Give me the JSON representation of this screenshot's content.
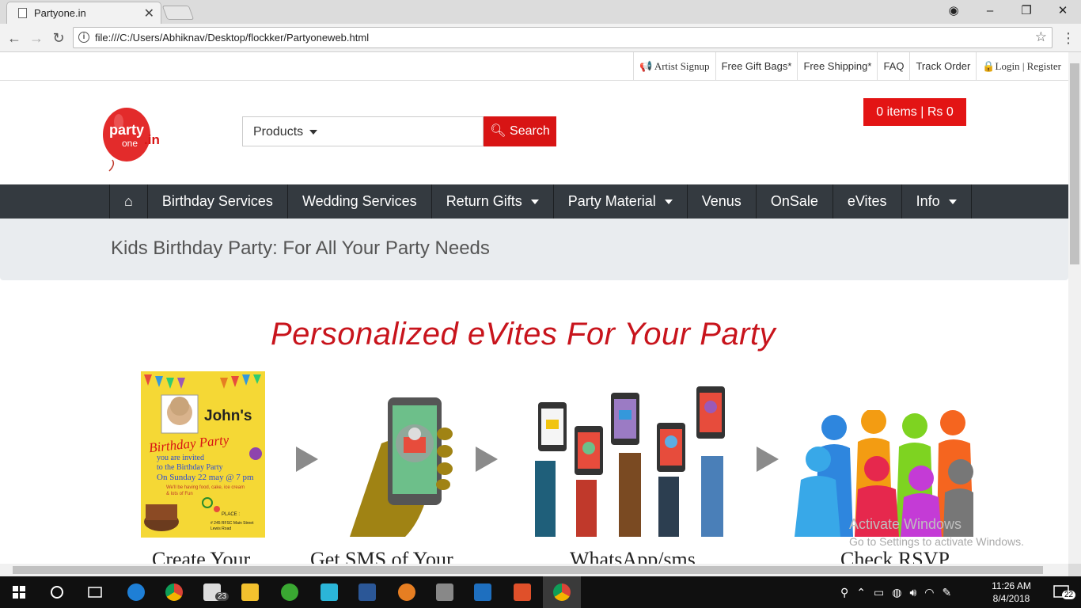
{
  "browser": {
    "tab_title": "Partyone.in",
    "tab_close": "✕",
    "url": "file:///C:/Users/Abhiknav/Desktop/flockker/Partyoneweb.html",
    "window_controls": {
      "user": "◉",
      "minimize": "–",
      "maximize": "❐",
      "close": "✕"
    }
  },
  "utility_links": [
    {
      "label": "Artist Signup",
      "icon": "megaphone-icon"
    },
    {
      "label": "Free Gift Bags*"
    },
    {
      "label": "Free Shipping*"
    },
    {
      "label": "FAQ"
    },
    {
      "label": "Track Order"
    },
    {
      "label": "Login",
      "icon": "lock-icon"
    },
    {
      "label": "Register"
    }
  ],
  "header": {
    "logo_text_top": "party",
    "logo_text_bottom": "one",
    "logo_suffix": ".in",
    "search_category": "Products",
    "search_button": "Search",
    "cart": "0 items | Rs 0"
  },
  "nav": {
    "home_icon": "home-icon",
    "items": [
      "Birthday Services",
      "Wedding Services",
      "Return Gifts",
      "Party Material",
      "Venus",
      "OnSale",
      "eVites",
      "Info"
    ]
  },
  "banner": {
    "heading": "Kids Birthday Party: For All Your Party Needs"
  },
  "evites": {
    "headline": "Personalized eVites For Your Party",
    "card": {
      "name": "John's",
      "title": "Birthday Party",
      "line1": "you are invited",
      "line2": "to the Birthday Party",
      "line3": "On Sunday 22 may @ 7 pm",
      "line4": "We'll be having food, cake, ice cream",
      "line5": "& lots of Fun",
      "place_label": "PLACE :",
      "place": "# 245 RFSC Main Street Lewis Road"
    },
    "captions": [
      "Create Your",
      "Get SMS of Your",
      "WhatsApp/sms",
      "Check RSVP"
    ]
  },
  "watermark": {
    "line1": "Activate Windows",
    "line2": "Go to Settings to activate Windows."
  },
  "taskbar": {
    "time": "11:26 AM",
    "date": "8/4/2018",
    "notifications": "22",
    "mail_badge": "23"
  }
}
